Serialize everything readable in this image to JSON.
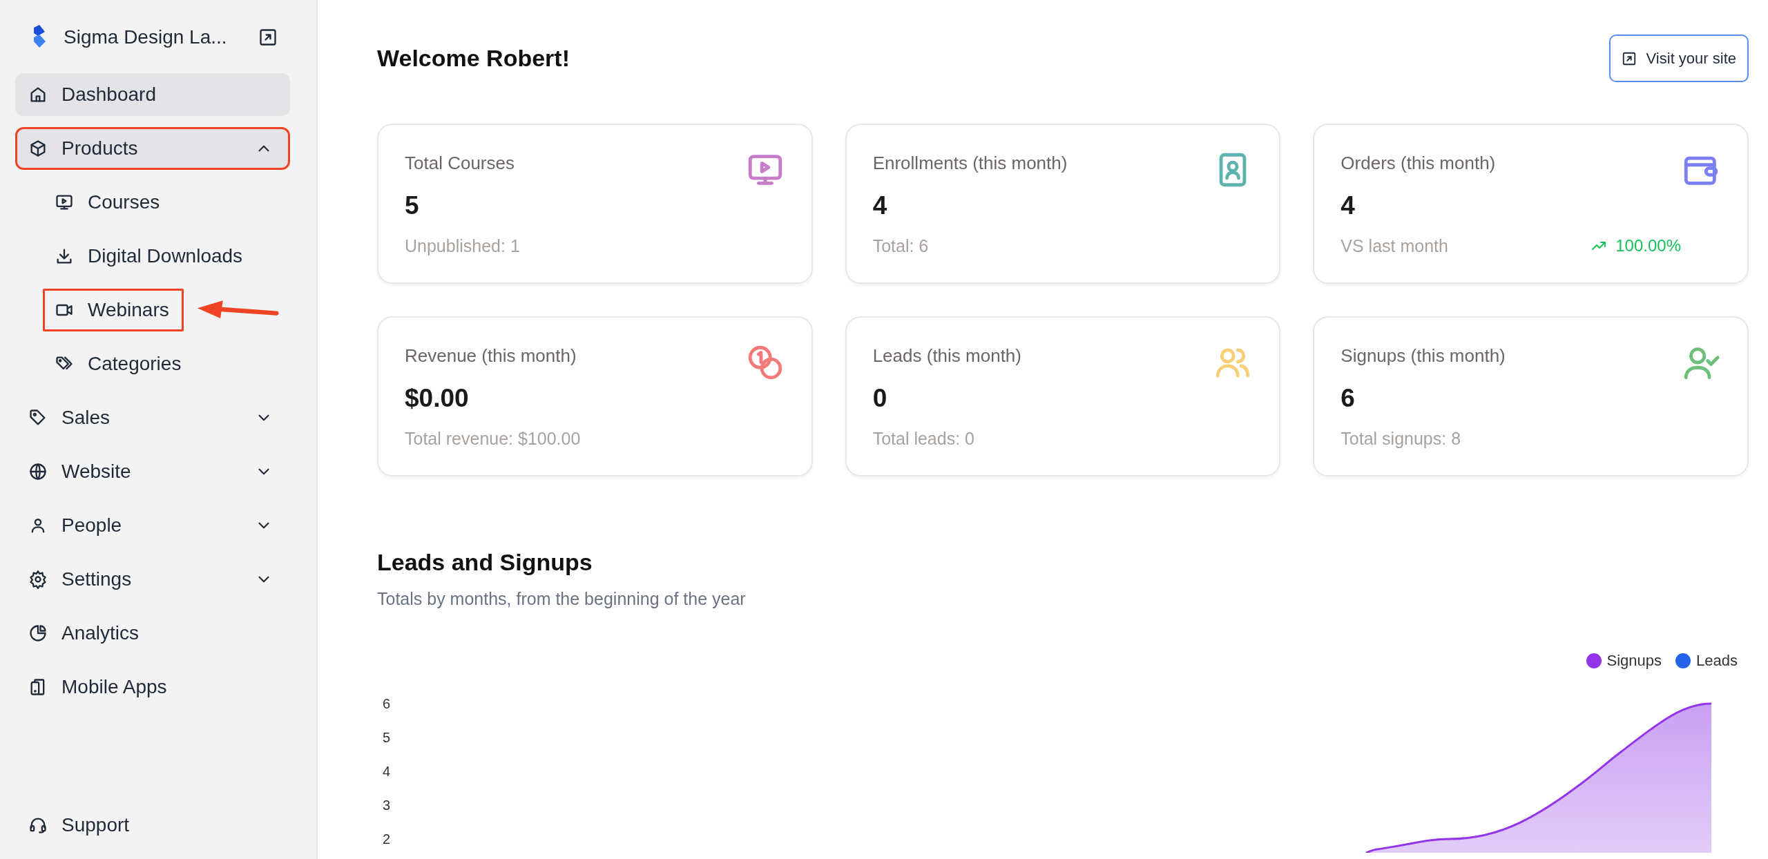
{
  "sidebar": {
    "brand": "Sigma Design La...",
    "items": [
      {
        "label": "Dashboard",
        "selected": true,
        "outlined": false
      },
      {
        "label": "Products",
        "selected": true,
        "outlined": true,
        "expanded": true,
        "children": [
          {
            "label": "Courses",
            "outlined": false,
            "arrow": false
          },
          {
            "label": "Digital Downloads",
            "outlined": false,
            "arrow": false
          },
          {
            "label": "Webinars",
            "outlined": true,
            "arrow": true
          },
          {
            "label": "Categories",
            "outlined": false,
            "arrow": false
          }
        ]
      },
      {
        "label": "Sales",
        "selected": false,
        "outlined": false,
        "expanded": false
      },
      {
        "label": "Website",
        "selected": false,
        "outlined": false,
        "expanded": false
      },
      {
        "label": "People",
        "selected": false,
        "outlined": false,
        "expanded": false
      },
      {
        "label": "Settings",
        "selected": false,
        "outlined": false,
        "expanded": false
      },
      {
        "label": "Analytics",
        "selected": false,
        "outlined": false
      },
      {
        "label": "Mobile Apps",
        "selected": false,
        "outlined": false
      }
    ],
    "footer": {
      "label": "Support"
    }
  },
  "header": {
    "title": "Welcome Robert!",
    "button": "Visit your site"
  },
  "stats": [
    {
      "title": "Total Courses",
      "value": "5",
      "sub": "Unpublished: 1",
      "color": "#c77dc9"
    },
    {
      "title": "Enrollments (this month)",
      "value": "4",
      "sub": "Total: 6",
      "color": "#5fb3ad"
    },
    {
      "title": "Orders (this month)",
      "value": "4",
      "sub": "VS last month",
      "trend": "100.00%",
      "color": "#7b7ff2"
    },
    {
      "title": "Revenue (this month)",
      "value": "$0.00",
      "sub": "Total revenue: $100.00",
      "color": "#f47a7a"
    },
    {
      "title": "Leads (this month)",
      "value": "0",
      "sub": "Total leads: 0",
      "color": "#f7cf79"
    },
    {
      "title": "Signups (this month)",
      "value": "6",
      "sub": "Total signups: 8",
      "color": "#6dbf7b"
    }
  ],
  "section": {
    "title": "Leads and Signups",
    "subtitle": "Totals by months, from the beginning of the year",
    "chart": {
      "y_labels": [
        "6",
        "5",
        "4",
        "3",
        "2"
      ],
      "legend": [
        {
          "name": "Signups",
          "color": "#9333ea"
        },
        {
          "name": "Leads",
          "color": "#2563eb"
        }
      ]
    }
  }
}
